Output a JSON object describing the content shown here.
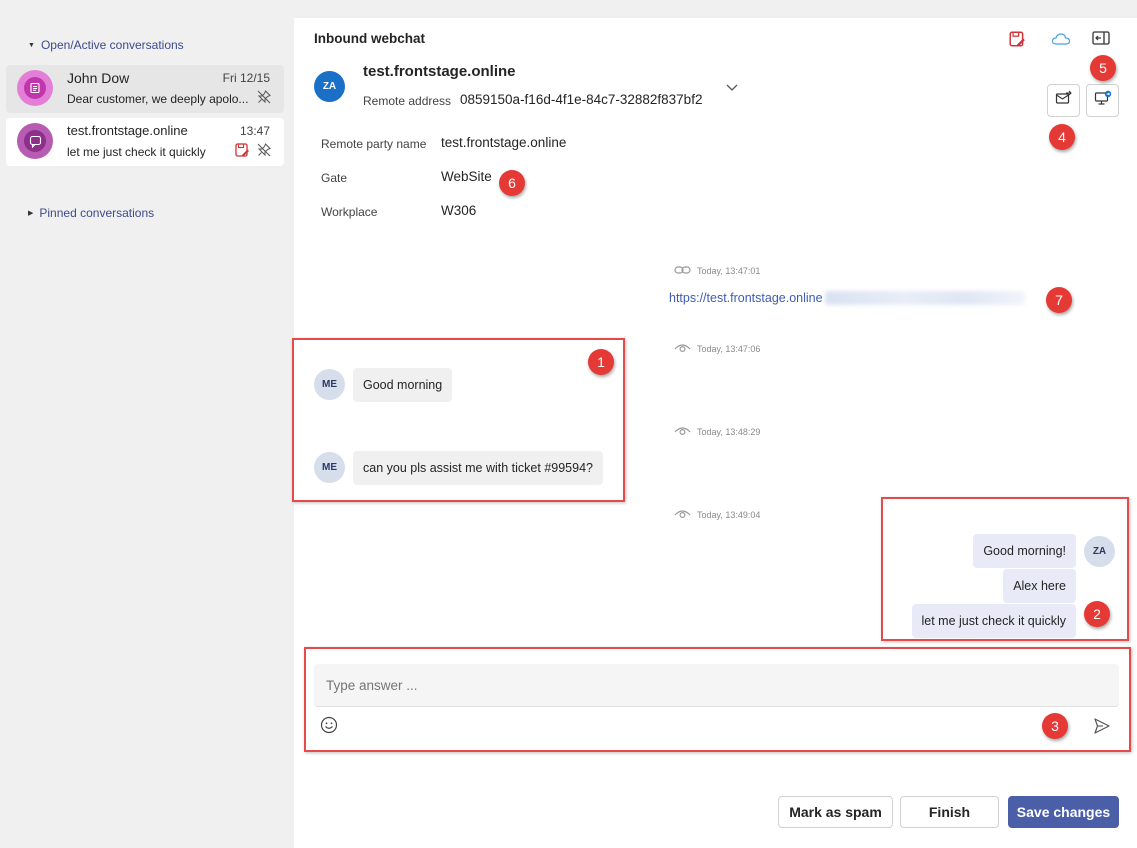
{
  "sidebar": {
    "open_group_label": "Open/Active conversations",
    "pinned_group_label": "Pinned conversations",
    "conversations": [
      {
        "name": "John Dow",
        "time": "Fri 12/15",
        "preview": "Dear customer, we deeply apolo...",
        "icon": "document-icon"
      },
      {
        "name": "test.frontstage.online",
        "time": "13:47",
        "preview": "let me just check it quickly",
        "icon": "chat-bubble-icon"
      }
    ]
  },
  "header": {
    "title": "Inbound webchat",
    "contact_initials": "ZA",
    "contact_name": "test.frontstage.online",
    "remote_address_label": "Remote address",
    "remote_address_value": "0859150a-f16d-4f1e-84c7-32882f837bf2"
  },
  "info": {
    "rows": [
      {
        "label": "Remote party name",
        "value": "test.frontstage.online"
      },
      {
        "label": "Gate",
        "value": "WebSite"
      },
      {
        "label": "Workplace",
        "value": "W306"
      }
    ]
  },
  "messages": {
    "timestamps": [
      "Today, 13:47:01",
      "Today, 13:47:06",
      "Today, 13:48:29",
      "Today, 13:49:04"
    ],
    "link_text": "https://test.frontstage.online",
    "incoming_initials": "ME",
    "incoming": [
      "Good morning",
      "can you pls assist me with ticket #99594?"
    ],
    "outgoing_initials": "ZA",
    "outgoing": [
      "Good morning!",
      "Alex here",
      "let me just check it quickly"
    ]
  },
  "composer": {
    "placeholder": "Type answer ..."
  },
  "footer": {
    "spam_label": "Mark as spam",
    "finish_label": "Finish",
    "save_label": "Save changes"
  },
  "annotations": [
    "1",
    "2",
    "3",
    "4",
    "5",
    "6",
    "7"
  ],
  "colors": {
    "accent": "#4a5fa8",
    "annotation_red": "#e53935",
    "contact_avatar": "#1a6fc7"
  }
}
